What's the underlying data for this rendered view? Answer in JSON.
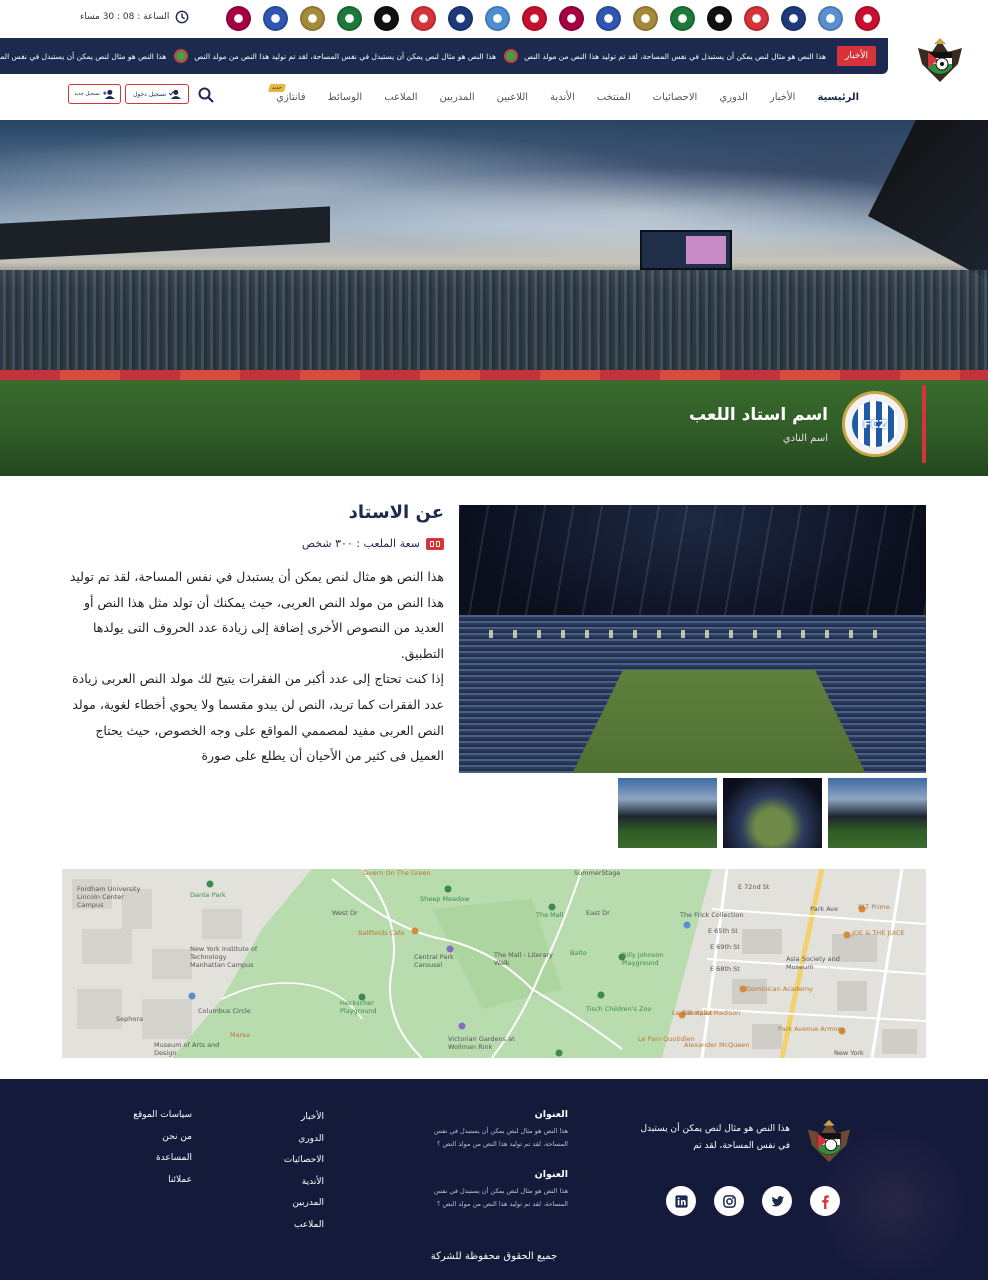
{
  "topbar": {
    "time_label": "الساعة : 08 : 30 مساء",
    "clubs": [
      {
        "color": "#c8102e"
      },
      {
        "color": "#5a8fd1"
      },
      {
        "color": "#1f3a7a"
      },
      {
        "color": "#d6333a"
      },
      {
        "color": "#111111"
      },
      {
        "color": "#1d7a3a"
      },
      {
        "color": "#a58a3c"
      },
      {
        "color": "#2f56b0"
      },
      {
        "color": "#a50044"
      },
      {
        "color": "#c8102e"
      },
      {
        "color": "#4f8fd1"
      },
      {
        "color": "#1f3a7a"
      },
      {
        "color": "#d6333a"
      },
      {
        "color": "#111111"
      },
      {
        "color": "#1d7a3a"
      },
      {
        "color": "#a58a3c"
      },
      {
        "color": "#2f56b0"
      },
      {
        "color": "#a50044"
      }
    ]
  },
  "ticker": {
    "label": "الأخبار",
    "items": [
      "هذا النص هو مثال لنص يمكن أن يستبدل في  نفس المساحة، لقد تم توليد هذا النص من مولد النص",
      "هذا النص هو مثال لنص يمكن أن يستبدل في  نفس المساحة، لقد تم توليد هذا النص من مولد النص",
      "هذا النص هو مثال لنص يمكن أن يستبدل في  نفس المساحة، لقد تم توليد هذا النص من مولد النص",
      "هذا النص هو مثال لنص يمكن أن يستبدل في  نفس المساحة، لقد تم توليد هذا النص من مولد النص"
    ]
  },
  "nav": {
    "items": [
      "الرئيسية",
      "الأخبار",
      "الدوري",
      "الاحصائيات",
      "المنتخب",
      "الأندية",
      "اللاعبين",
      "المدربين",
      "الملاعب",
      "الوسائط",
      "فانتازي"
    ],
    "new_badge": "جديد",
    "login_label": "تسجيل دخول",
    "register_label": "تسجيل جديد"
  },
  "hero": {
    "stadium_name": "اسم استاد اللعب",
    "club_name": "اسم النادي",
    "crest_text": "FCZ"
  },
  "about": {
    "title": "عن الاستاد",
    "capacity": "سعة الملعب : ٣٠٠ شخص",
    "paragraphs": [
      "هذا النص هو مثال لنص يمكن أن يستبدل في نفس المساحة، لقد تم توليد هذا النص من مولد النص العربى، حيث يمكنك أن تولد مثل هذا النص أو العديد من النصوص الأخرى إضافة إلى زيادة عدد الحروف التى يولدها التطبيق.",
      "إذا كنت تحتاج إلى عدد أكبر من الفقرات يتيح لك مولد النص العربى زيادة عدد الفقرات كما تريد، النص لن يبدو مقسما ولا يحوي أخطاء لغوية، مولد النص العربى مفيد لمصممي المواقع على وجه الخصوص، حيث يحتاج العميل فى كثير من الأحيان أن يطلع على صورة"
    ]
  },
  "map": {
    "labels": [
      {
        "text": "Fordham University Lincoln Center Campus",
        "tone": "dark"
      },
      {
        "text": "Dante Park",
        "tone": "green"
      },
      {
        "text": "New York Institute of Technology Manhattan Campus",
        "tone": "dark"
      },
      {
        "text": "Tavern On The Green",
        "tone": "orange"
      },
      {
        "text": "Sheep Meadow",
        "tone": "green"
      },
      {
        "text": "SummerStage",
        "tone": "dark"
      },
      {
        "text": "The Mall",
        "tone": "green"
      },
      {
        "text": "Ballfields Cafe",
        "tone": "orange"
      },
      {
        "text": "Central Park Carousel",
        "tone": "dark"
      },
      {
        "text": "The Mall - Literary Walk",
        "tone": "dark"
      },
      {
        "text": "Billy Johnson Playground",
        "tone": "green"
      },
      {
        "text": "Balto",
        "tone": "green"
      },
      {
        "text": "Heckscher Playground",
        "tone": "green"
      },
      {
        "text": "Tisch Children's Zoo",
        "tone": "green"
      },
      {
        "text": "Victorian Gardens at Wollman Rink",
        "tone": "dark"
      },
      {
        "text": "Columbus Circle",
        "tone": "dark"
      },
      {
        "text": "Sephora",
        "tone": "dark"
      },
      {
        "text": "Museum of Arts and Design",
        "tone": "dark"
      },
      {
        "text": "Marea",
        "tone": "orange"
      },
      {
        "text": "The Frick Collection",
        "tone": "dark"
      },
      {
        "text": "E 72nd St",
        "tone": "dark"
      },
      {
        "text": "Park Ave",
        "tone": "dark"
      },
      {
        "text": "BLT Prime",
        "tone": "orange"
      },
      {
        "text": "JOE & THE JUICE",
        "tone": "orange"
      },
      {
        "text": "Asia Society and Museum",
        "tone": "dark"
      },
      {
        "text": "Dominican Academy",
        "tone": "orange"
      },
      {
        "text": "Bar Italia Madison",
        "tone": "orange"
      },
      {
        "text": "Park Avenue Armory",
        "tone": "orange"
      },
      {
        "text": "Le Pain Quotidien",
        "tone": "orange"
      },
      {
        "text": "Alexander McQueen",
        "tone": "orange"
      },
      {
        "text": "Le Bilboquet",
        "tone": "orange"
      },
      {
        "text": "New York",
        "tone": "dark"
      },
      {
        "text": "E 69th St",
        "tone": "dark"
      },
      {
        "text": "E 68th St",
        "tone": "dark"
      },
      {
        "text": "E 65th St",
        "tone": "dark"
      },
      {
        "text": "West Dr",
        "tone": "dark"
      },
      {
        "text": "East Dr",
        "tone": "dark"
      }
    ]
  },
  "footer": {
    "about": "هذا النص هو مثال لنص يمكن أن يستبدل في نفس المساحة، لقد تم",
    "address_blocks": [
      {
        "title": "العنوان",
        "text": "هذا النص هو مثال لنص يمكن أن يستبدل في نفس المساحة، لقد تم توليد هذا النص من مولد النص ؟"
      },
      {
        "title": "العنوان",
        "text": "هذا النص هو مثال لنص يمكن أن يستبدل في نفس المساحة، لقد تم توليد هذا النص من مولد النص ؟"
      }
    ],
    "links_1": [
      "الأخبار",
      "الدوري",
      "الاحصائيات",
      "الأندية",
      "المدربين",
      "الملاعب"
    ],
    "links_2": [
      "سياسات الموقع",
      "من نحن",
      "المساعدة",
      "عملائنا"
    ],
    "copyright": "جميع الحقوق محفوظة للشركة",
    "socials": [
      "facebook-icon",
      "twitter-icon",
      "instagram-icon",
      "linkedin-icon"
    ]
  },
  "colors": {
    "navy": "#1b2a4e",
    "red": "#d6333a",
    "footer_bg": "#131a3a",
    "gold": "#e6b73c"
  }
}
